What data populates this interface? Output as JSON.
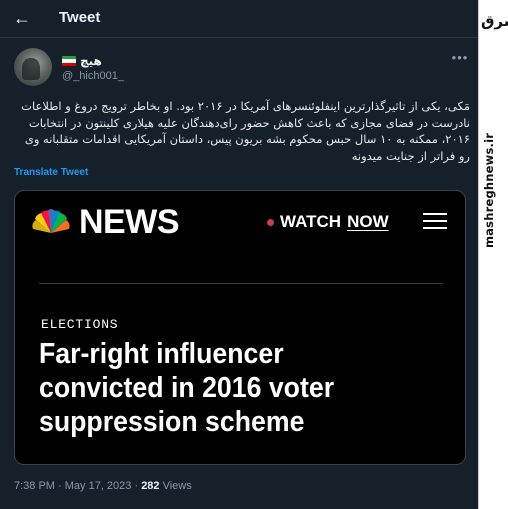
{
  "header": {
    "title": "Tweet",
    "back_icon": "arrow-left-icon"
  },
  "author": {
    "display_name": "هیچ",
    "handle": "@_hich001_",
    "flag_colors": [
      "#239f40",
      "#ffffff",
      "#da0000"
    ],
    "more_icon": "ellipsis-icon"
  },
  "tweet": {
    "text": "مَکی، یکی از تاثیرگذارترین اینفلوئنسرهای آمریکا در ۲۰۱۶ بود. او بخاطر ترویج دروغ و اطلاعات نادرست در فضای مجازی که باعث کاهش حضور رای‌دهندگان علیه هیلاری کلینتون در انتخابات ۲۰۱۶، ممکنه به ۱۰ سال حبس محکوم بشه بریون پیس، داستان آمریکایی اقدامات متقلبانه وی رو فراتر از جنایت میدونه",
    "translate_label": "Translate Tweet"
  },
  "card": {
    "brand": "NEWS",
    "watch_label": "WATCH",
    "now_label": "NOW",
    "section": "ELECTIONS",
    "headline_lines": [
      "Far-right influencer",
      "convicted in 2016 voter",
      "suppression scheme"
    ],
    "live_dot_color": "#c7414b",
    "peacock_colors": [
      "#fccc12",
      "#ef1541",
      "#6460aa",
      "#0089d0",
      "#0db14b",
      "#f37021"
    ]
  },
  "meta": {
    "time": "7:38 PM",
    "separator": " · ",
    "date": "May 17, 2023",
    "separator2": " · ",
    "views_count": "282",
    "views_label": " Views"
  },
  "watermark": {
    "logo": "مشرق",
    "url": "mashreghnews.ir"
  }
}
